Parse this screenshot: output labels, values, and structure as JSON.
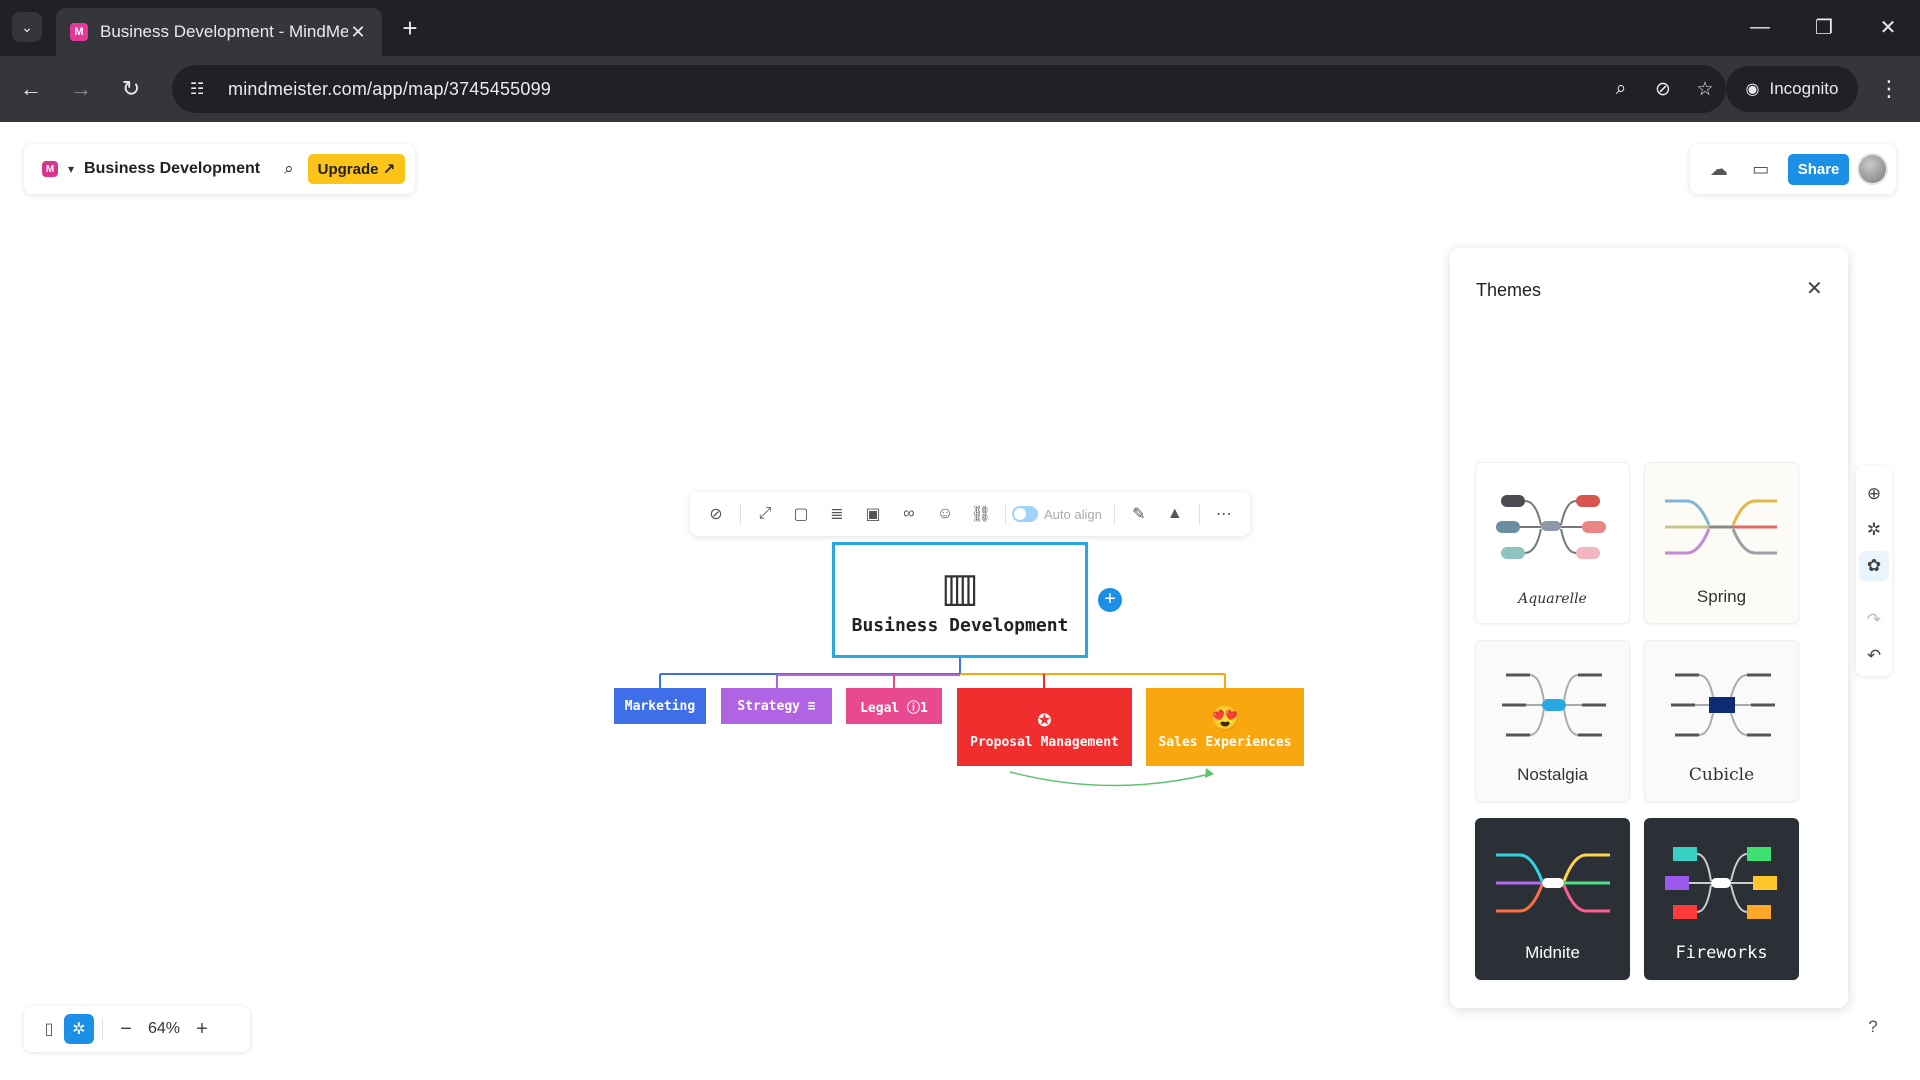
{
  "browser": {
    "tab_title": "Business Development - MindMeister",
    "favicon_letter": "M",
    "url": "mindmeister.com/app/map/3745455099",
    "incognito_label": "Incognito"
  },
  "header": {
    "logo_letter": "M",
    "map_title": "Business Development",
    "upgrade_label": "Upgrade ↗",
    "share_label": "Share"
  },
  "toolbar": {
    "auto_align_label": "Auto align"
  },
  "mindmap": {
    "root": "Business Development",
    "children": [
      {
        "label": "Marketing",
        "color": "#3f6fe8"
      },
      {
        "label": "Strategy ≡",
        "color": "#b064e3"
      },
      {
        "label": "Legal ⓘ1",
        "color": "#e94990"
      },
      {
        "label": "Proposal Management",
        "color": "#f12e2e"
      },
      {
        "label": "Sales Experiences",
        "color": "#f9a70f"
      }
    ]
  },
  "themes": {
    "title": "Themes",
    "items": [
      {
        "name": "Aquarelle"
      },
      {
        "name": "Spring"
      },
      {
        "name": "Nostalgia"
      },
      {
        "name": "Cubicle"
      },
      {
        "name": "Midnite"
      },
      {
        "name": "Fireworks"
      }
    ]
  },
  "zoom": {
    "value": "64%"
  },
  "colors": {
    "accent": "#1c8fe6",
    "upgrade": "#fcc419",
    "root_border": "#29a8e0"
  }
}
